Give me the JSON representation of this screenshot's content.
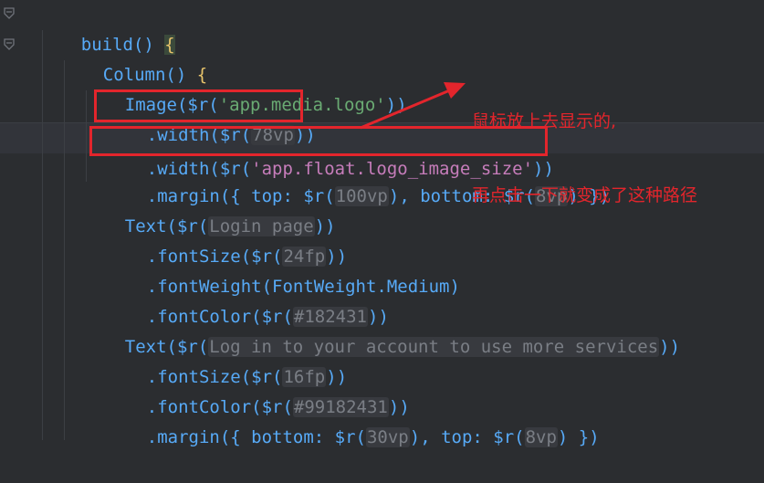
{
  "code": {
    "lines": [
      {
        "parts": [
          "build() ",
          "{"
        ]
      },
      {
        "parts": [
          "Column() ",
          "{"
        ]
      },
      {
        "parts": [
          "Image($r(",
          "'app.media.logo'",
          "))"
        ]
      },
      {
        "parts": [
          ".width($r(",
          "78vp",
          "))"
        ]
      },
      {
        "parts": [
          ".width($r(",
          "'app.float.logo_image_size'",
          "))"
        ]
      },
      {
        "parts": [
          ".margin({ top: $r(",
          "100vp",
          "), bottom: $r(",
          "8vp",
          ") })"
        ]
      },
      {
        "parts": [
          "Text($r(",
          "Login page",
          "))"
        ]
      },
      {
        "parts": [
          ".fontSize($r(",
          "24fp",
          "))"
        ]
      },
      {
        "parts": [
          ".fontWeight(FontWeight.Medium)"
        ]
      },
      {
        "parts": [
          ".fontColor($r(",
          "#182431",
          "))"
        ]
      },
      {
        "parts": [
          "Text($r(",
          "Log in to your account to use more services",
          "))"
        ]
      },
      {
        "parts": [
          ".fontSize($r(",
          "16fp",
          "))"
        ]
      },
      {
        "parts": [
          ".fontColor($r(",
          "#99182431",
          "))"
        ]
      },
      {
        "parts": [
          ".margin({ bottom: $r(",
          "30vp",
          "), top: $r(",
          "8vp",
          ") })"
        ]
      }
    ]
  },
  "annotation": {
    "line1": "鼠标放上去显示的,",
    "line2": "再点击一下就变成了这种路径"
  },
  "colors": {
    "background": "#2b2d30",
    "annotation_red": "#e3252c",
    "function_blue": "#57aaf7",
    "string_green": "#6aab73",
    "property_purple": "#c77dbb"
  },
  "icons": [
    "fold-arrow-icon",
    "fold-arrow-icon"
  ]
}
